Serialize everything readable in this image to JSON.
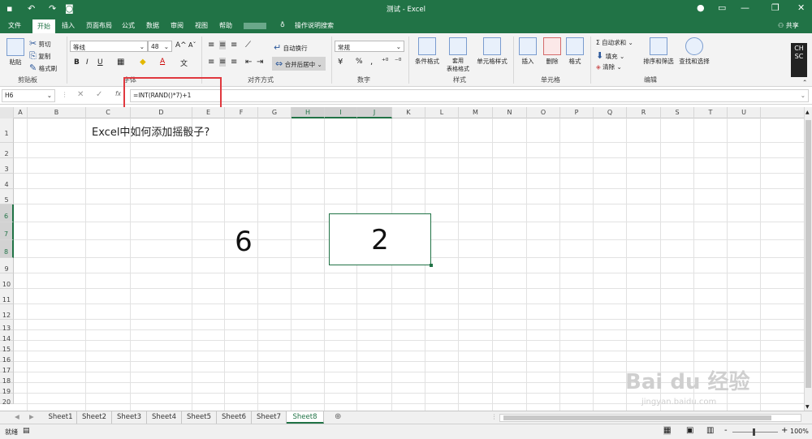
{
  "title": "测试 - Excel",
  "user": {
    "share": "共享"
  },
  "tabs": [
    "文件",
    "开始",
    "插入",
    "页面布局",
    "公式",
    "数据",
    "审阅",
    "视图",
    "帮助"
  ],
  "tell_me": "操作说明搜索",
  "ribbon": {
    "clipboard": {
      "paste": "粘贴",
      "cut": "剪切",
      "copy": "复制",
      "format_painter": "格式刷",
      "label": "剪贴板"
    },
    "font": {
      "name": "等线",
      "size": "48",
      "bold": "B",
      "italic": "I",
      "underline": "U",
      "label": "字体",
      "grow": "A",
      "shrink": "A",
      "color_a": "A"
    },
    "alignment": {
      "wrap": "自动换行",
      "merge": "合并后居中",
      "label": "对齐方式"
    },
    "number": {
      "format": "常规",
      "percent": "%",
      "comma": ",",
      "label": "数字"
    },
    "styles": {
      "cond": "条件格式",
      "table": "套用\n表格格式",
      "cell": "单元格样式",
      "label": "样式"
    },
    "cells": {
      "insert": "插入",
      "delete": "删除",
      "format": "格式",
      "label": "单元格"
    },
    "editing": {
      "autosum": "自动求和",
      "fill": "填充",
      "clear": "清除",
      "sort": "排序和筛选",
      "find": "查找和选择",
      "label": "编辑"
    },
    "side": {
      "c": "C",
      "h": "H",
      "s": "S",
      "cc": "C"
    }
  },
  "formula_bar": {
    "namebox": "H6",
    "fx": "fx",
    "formula": "=INT(RAND()*7)+1"
  },
  "columns": [
    "A",
    "B",
    "C",
    "D",
    "E",
    "F",
    "G",
    "H",
    "I",
    "J",
    "K",
    "L",
    "M",
    "N",
    "O",
    "P",
    "Q",
    "R",
    "S",
    "T",
    "U"
  ],
  "rows": [
    "1",
    "2",
    "3",
    "4",
    "5",
    "6",
    "7",
    "8",
    "9",
    "10",
    "11",
    "12",
    "13",
    "14",
    "15",
    "16",
    "17",
    "18",
    "19",
    "20"
  ],
  "cells": {
    "b1": "Excel中如何添加摇骰子?",
    "dice1": "6",
    "dice2": "2"
  },
  "sheets": [
    "Sheet1",
    "Sheet2",
    "Sheet3",
    "Sheet4",
    "Sheet5",
    "Sheet6",
    "Sheet7",
    "Sheet8"
  ],
  "status": {
    "ready": "就绪",
    "zoom": "100%",
    "minus": "-",
    "plus": "+"
  },
  "watermark": {
    "brand": "Bai du 经验",
    "url": "jingyan.baidu.com"
  }
}
